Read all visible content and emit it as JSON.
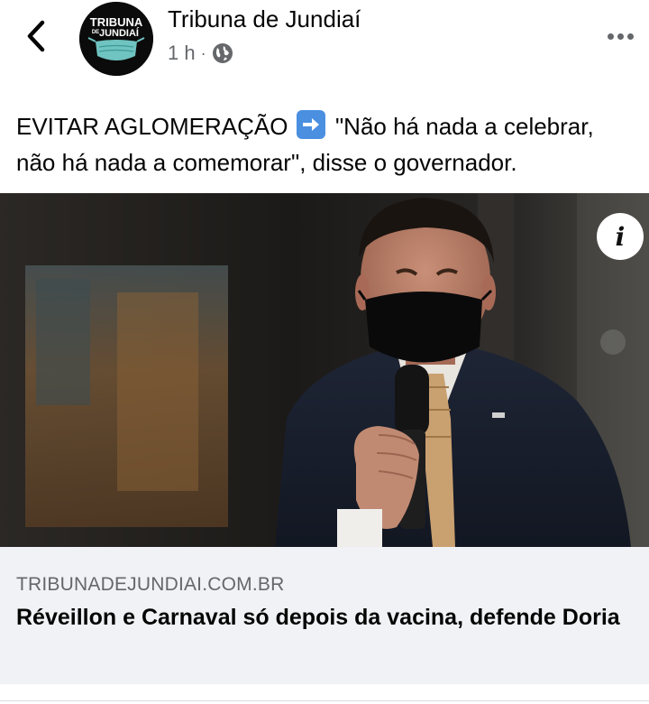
{
  "header": {
    "page_name": "Tribuna de Jundiaí",
    "time": "1 h",
    "separator": "·",
    "privacy_icon": "globe-icon",
    "back_icon": "chevron-left-icon",
    "more_icon": "more-horizontal-icon"
  },
  "avatar": {
    "logo_text_top": "TRIBUNA",
    "logo_text_de": "DE",
    "logo_text_bottom": "JUNDIAÍ",
    "logo_colors": {
      "background": "#0b0b0b",
      "mask": "#6fc3c0"
    }
  },
  "post": {
    "text_before_emoji": "EVITAR AGLOMERAÇÃO",
    "emoji": "right-arrow-emoji",
    "text_after_emoji": " \"Não há nada a celebrar, não há nada a comemorar\", disse o governador."
  },
  "photo": {
    "info_label": "i"
  },
  "link": {
    "domain": "TRIBUNADEJUNDIAI.COM.BR",
    "title": "Réveillon e Carnaval só depois da vacina, defende Doria"
  },
  "colors": {
    "text_primary": "#050505",
    "text_secondary": "#65676b",
    "link_card_bg": "#f0f2f5",
    "emoji_blue": "#4a8fe0"
  }
}
